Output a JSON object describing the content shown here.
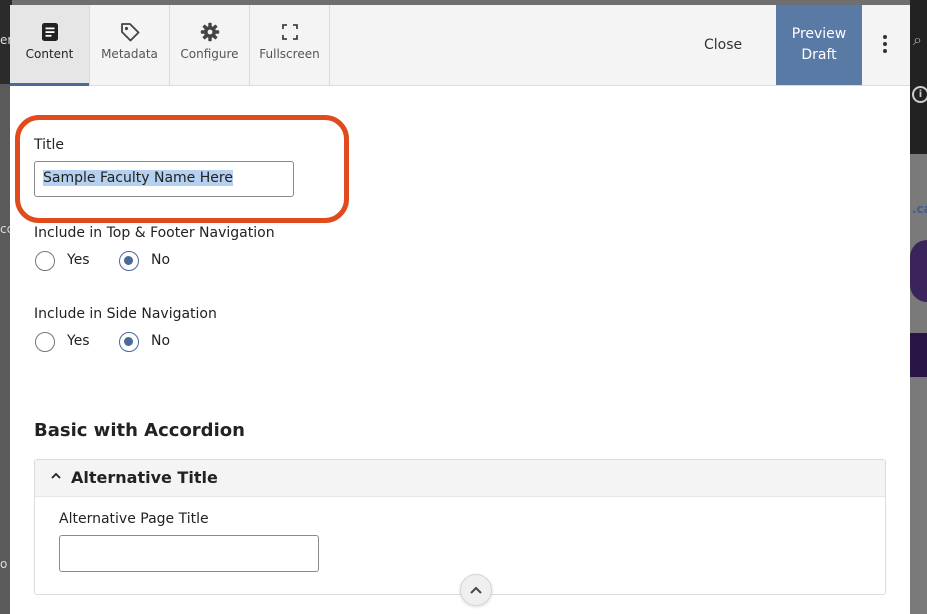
{
  "toolbar": {
    "tabs": [
      {
        "label": "Content",
        "icon": "document-icon",
        "active": true
      },
      {
        "label": "Metadata",
        "icon": "tag-icon",
        "active": false
      },
      {
        "label": "Configure",
        "icon": "gear-icon",
        "active": false
      },
      {
        "label": "Fullscreen",
        "icon": "expand-icon",
        "active": false
      }
    ],
    "close_label": "Close",
    "preview_label_line1": "Preview",
    "preview_label_line2": "Draft"
  },
  "form": {
    "title_label": "Title",
    "title_value": "Sample Faculty Name Here",
    "top_nav": {
      "label": "Include in Top & Footer Navigation",
      "options": [
        "Yes",
        "No"
      ],
      "selected": "No"
    },
    "side_nav": {
      "label": "Include in Side Navigation",
      "options": [
        "Yes",
        "No"
      ],
      "selected": "No"
    },
    "section_heading": "Basic with Accordion",
    "accordion": {
      "title": "Alternative Title",
      "field_label": "Alternative Page Title",
      "field_value": ""
    }
  },
  "colors": {
    "accent": "#4a6a9a",
    "preview_button": "#5a7aa6",
    "highlight": "#e04a1c",
    "selection": "#b6d0ef"
  },
  "background_fragments": {
    "left_top": "er",
    "left_mid1": "cc",
    "left_mid2": "o",
    "right_link": ".ca"
  }
}
